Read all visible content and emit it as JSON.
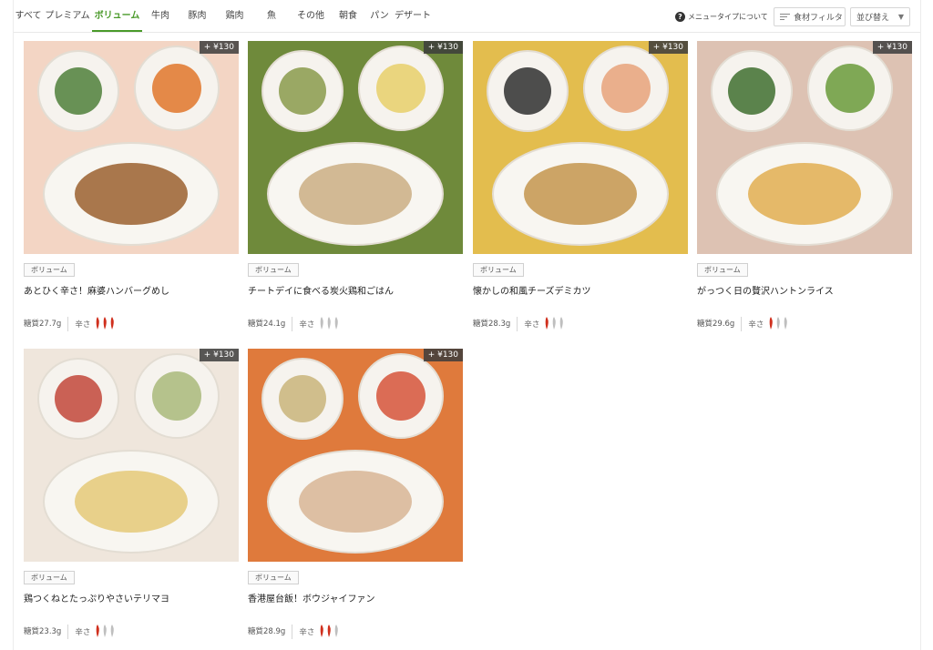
{
  "tabs": [
    {
      "label": "すべて",
      "width": 32,
      "active": false
    },
    {
      "label": "プレミアム",
      "width": 54,
      "active": false
    },
    {
      "label": "ボリューム",
      "width": 55,
      "active": true
    },
    {
      "label": "牛肉",
      "width": 40,
      "active": false
    },
    {
      "label": "豚肉",
      "width": 41,
      "active": false
    },
    {
      "label": "鶏肉",
      "width": 41,
      "active": false
    },
    {
      "label": "魚",
      "width": 40,
      "active": false
    },
    {
      "label": "その他",
      "width": 46,
      "active": false
    },
    {
      "label": "朝食",
      "width": 36,
      "active": false
    },
    {
      "label": "パン",
      "width": 33,
      "active": false
    },
    {
      "label": "デザート",
      "width": 40,
      "active": false
    }
  ],
  "toolbar": {
    "help_label": "メニュータイプについて",
    "filter_label": "食材フィルタ",
    "sort_label": "並び替え"
  },
  "cards": [
    {
      "price": "+ ¥130",
      "tag": "ボリューム",
      "title": "あとひく辛さ！麻婆ハンバーグめし",
      "carb": "糖質27.7g",
      "spice_label": "辛さ",
      "spice_level": 3,
      "bg": "#f3d5c4"
    },
    {
      "price": "+ ¥130",
      "tag": "ボリューム",
      "title": "チートデイに食べる炭火鶏和ごはん",
      "carb": "糖質24.1g",
      "spice_label": "辛さ",
      "spice_level": 0,
      "bg": "#6f8a3b"
    },
    {
      "price": "+ ¥130",
      "tag": "ボリューム",
      "title": "懐かしの和風チーズデミカツ",
      "carb": "糖質28.3g",
      "spice_label": "辛さ",
      "spice_level": 1,
      "bg": "#e3bd4e"
    },
    {
      "price": "+ ¥130",
      "tag": "ボリューム",
      "title": "がっつく日の贅沢ハントンライス",
      "carb": "糖質29.6g",
      "spice_label": "辛さ",
      "spice_level": 1,
      "bg": "#ddc2b3"
    },
    {
      "price": "+ ¥130",
      "tag": "ボリューム",
      "title": "鶏つくねとたっぷりやさいテリマヨ",
      "carb": "糖質23.3g",
      "spice_label": "辛さ",
      "spice_level": 1,
      "bg": "#efe6dc"
    },
    {
      "price": "+ ¥130",
      "tag": "ボリューム",
      "title": "香港屋台飯！ボウジャイファン",
      "carb": "糖質28.9g",
      "spice_label": "辛さ",
      "spice_level": 2,
      "bg": "#df7a3c"
    }
  ]
}
